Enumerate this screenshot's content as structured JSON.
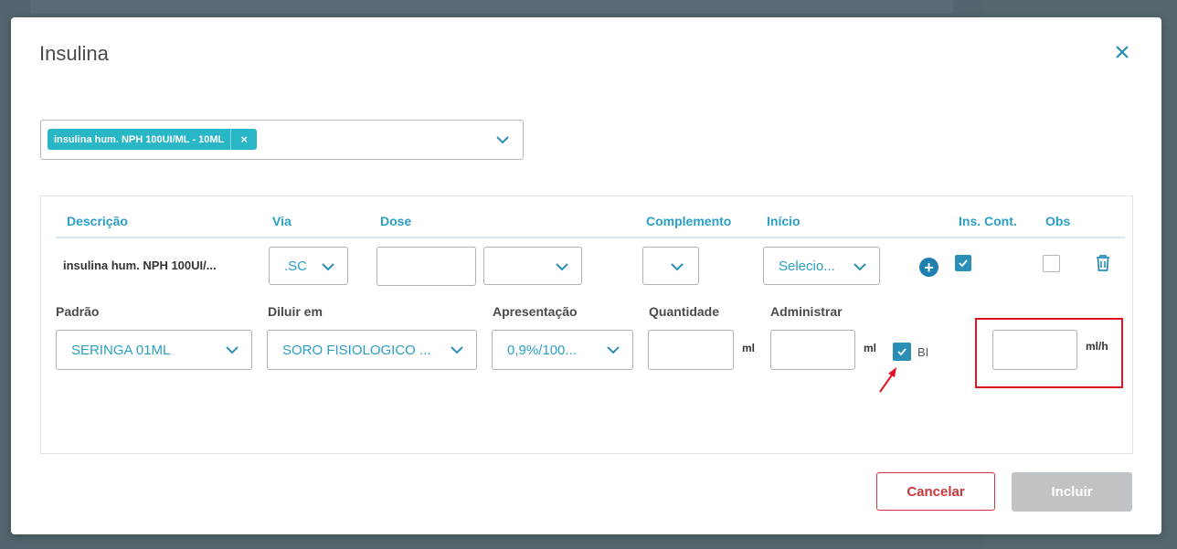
{
  "dialog": {
    "title": "Insulina"
  },
  "medication_select": {
    "chip_label": "insulina hum. NPH 100UI/ML - 10ML",
    "chip_remove": "×"
  },
  "table": {
    "headers": {
      "descricao": "Descrição",
      "via": "Via",
      "dose": "Dose",
      "complemento": "Complemento",
      "inicio": "Início",
      "ins_cont": "Ins. Cont.",
      "obs": "Obs"
    },
    "row": {
      "descricao": "insulina hum. NPH 100UI/...",
      "via": ".SC",
      "dose_value": "",
      "dose_unit": "",
      "complemento": "",
      "inicio": "Selecio...",
      "ins_cont_checked": true,
      "obs_checked": false
    }
  },
  "detail": {
    "padrao_label": "Padrão",
    "padrao_value": "SERINGA 01ML",
    "diluir_label": "Diluir em",
    "diluir_value": "SORO FISIOLOGICO ...",
    "apresentacao_label": "Apresentação",
    "apresentacao_value": "0,9%/100...",
    "quantidade_label": "Quantidade",
    "quantidade_value": "",
    "quantidade_unit": "ml",
    "administrar_label": "Administrar",
    "administrar_value": "",
    "administrar_unit": "ml",
    "bi_label": "BI",
    "bi_checked": true,
    "rate_value": "",
    "rate_unit": "ml/h"
  },
  "footer": {
    "cancel_label": "Cancelar",
    "submit_label": "Incluir"
  },
  "colors": {
    "accent": "#2a9fc4",
    "chip": "#29b6c6",
    "cancel": "#c9373c",
    "highlight": "#e0141e",
    "disabled": "#bfc3c5"
  },
  "icons": [
    "close-icon",
    "chevron-down-icon",
    "plus-circle-icon",
    "trash-icon",
    "check-icon",
    "arrow-annotation-icon"
  ]
}
